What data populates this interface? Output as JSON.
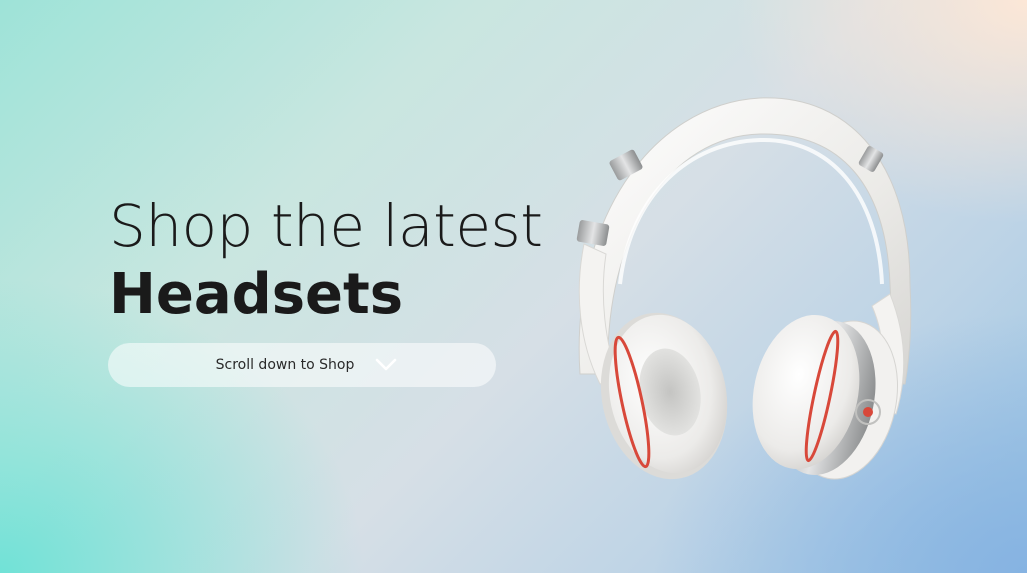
{
  "hero": {
    "title_line1": "Shop the latest",
    "title_line2": "Headsets",
    "cta_label": "Scroll down to Shop",
    "cta_icon": "chevron-down-icon",
    "product_image": "white-headphones-image"
  },
  "colors": {
    "text": "#1a1a1a",
    "accent_red": "#d8483a",
    "bg_teal": "#6fe0d4",
    "bg_peach": "#ffe6d4",
    "bg_blue": "#86b2e0"
  }
}
